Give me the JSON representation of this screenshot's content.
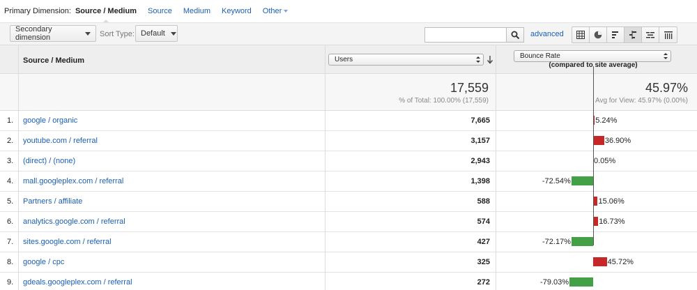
{
  "dimension_bar": {
    "label": "Primary Dimension:",
    "active": "Source / Medium",
    "links": [
      "Source",
      "Medium",
      "Keyword"
    ],
    "other": "Other"
  },
  "toolbar": {
    "secondary_dimension": "Secondary dimension",
    "sort_type_label": "Sort Type:",
    "sort_type_value": "Default",
    "search_value": "",
    "advanced": "advanced"
  },
  "table": {
    "headers": {
      "source": "Source / Medium",
      "users": "Users",
      "bounce_rate": "Bounce Rate",
      "compared": "(compared to site average)"
    },
    "totals": {
      "users": "17,559",
      "users_sub": "% of Total: 100.00% (17,559)",
      "bounce_rate": "45.97%",
      "bounce_rate_sub": "Avg for View: 45.97% (0.00%)"
    },
    "rows": [
      {
        "n": "1.",
        "source": "google / organic",
        "users": "7,665",
        "delta_label": "5.24%",
        "delta": 5.24
      },
      {
        "n": "2.",
        "source": "youtube.com / referral",
        "users": "3,157",
        "delta_label": "36.90%",
        "delta": 36.9
      },
      {
        "n": "3.",
        "source": "(direct) / (none)",
        "users": "2,943",
        "delta_label": "0.05%",
        "delta": 0.05
      },
      {
        "n": "4.",
        "source": "mall.googleplex.com / referral",
        "users": "1,398",
        "delta_label": "-72.54%",
        "delta": -72.54
      },
      {
        "n": "5.",
        "source": "Partners / affiliate",
        "users": "588",
        "delta_label": "15.06%",
        "delta": 15.06
      },
      {
        "n": "6.",
        "source": "analytics.google.com / referral",
        "users": "574",
        "delta_label": "16.73%",
        "delta": 16.73
      },
      {
        "n": "7.",
        "source": "sites.google.com / referral",
        "users": "427",
        "delta_label": "-72.17%",
        "delta": -72.17
      },
      {
        "n": "8.",
        "source": "google / cpc",
        "users": "325",
        "delta_label": "45.72%",
        "delta": 45.72
      },
      {
        "n": "9.",
        "source": "gdeals.googleplex.com / referral",
        "users": "272",
        "delta_label": "-79.03%",
        "delta": -79.03
      }
    ]
  },
  "colors": {
    "link": "#1a5fb4",
    "above_average": "#c62828",
    "below_average": "#43a047"
  },
  "icons": [
    "search-icon",
    "table-view-icon",
    "pie-view-icon",
    "performance-view-icon",
    "comparison-view-icon",
    "term-cloud-view-icon",
    "pivot-view-icon"
  ]
}
